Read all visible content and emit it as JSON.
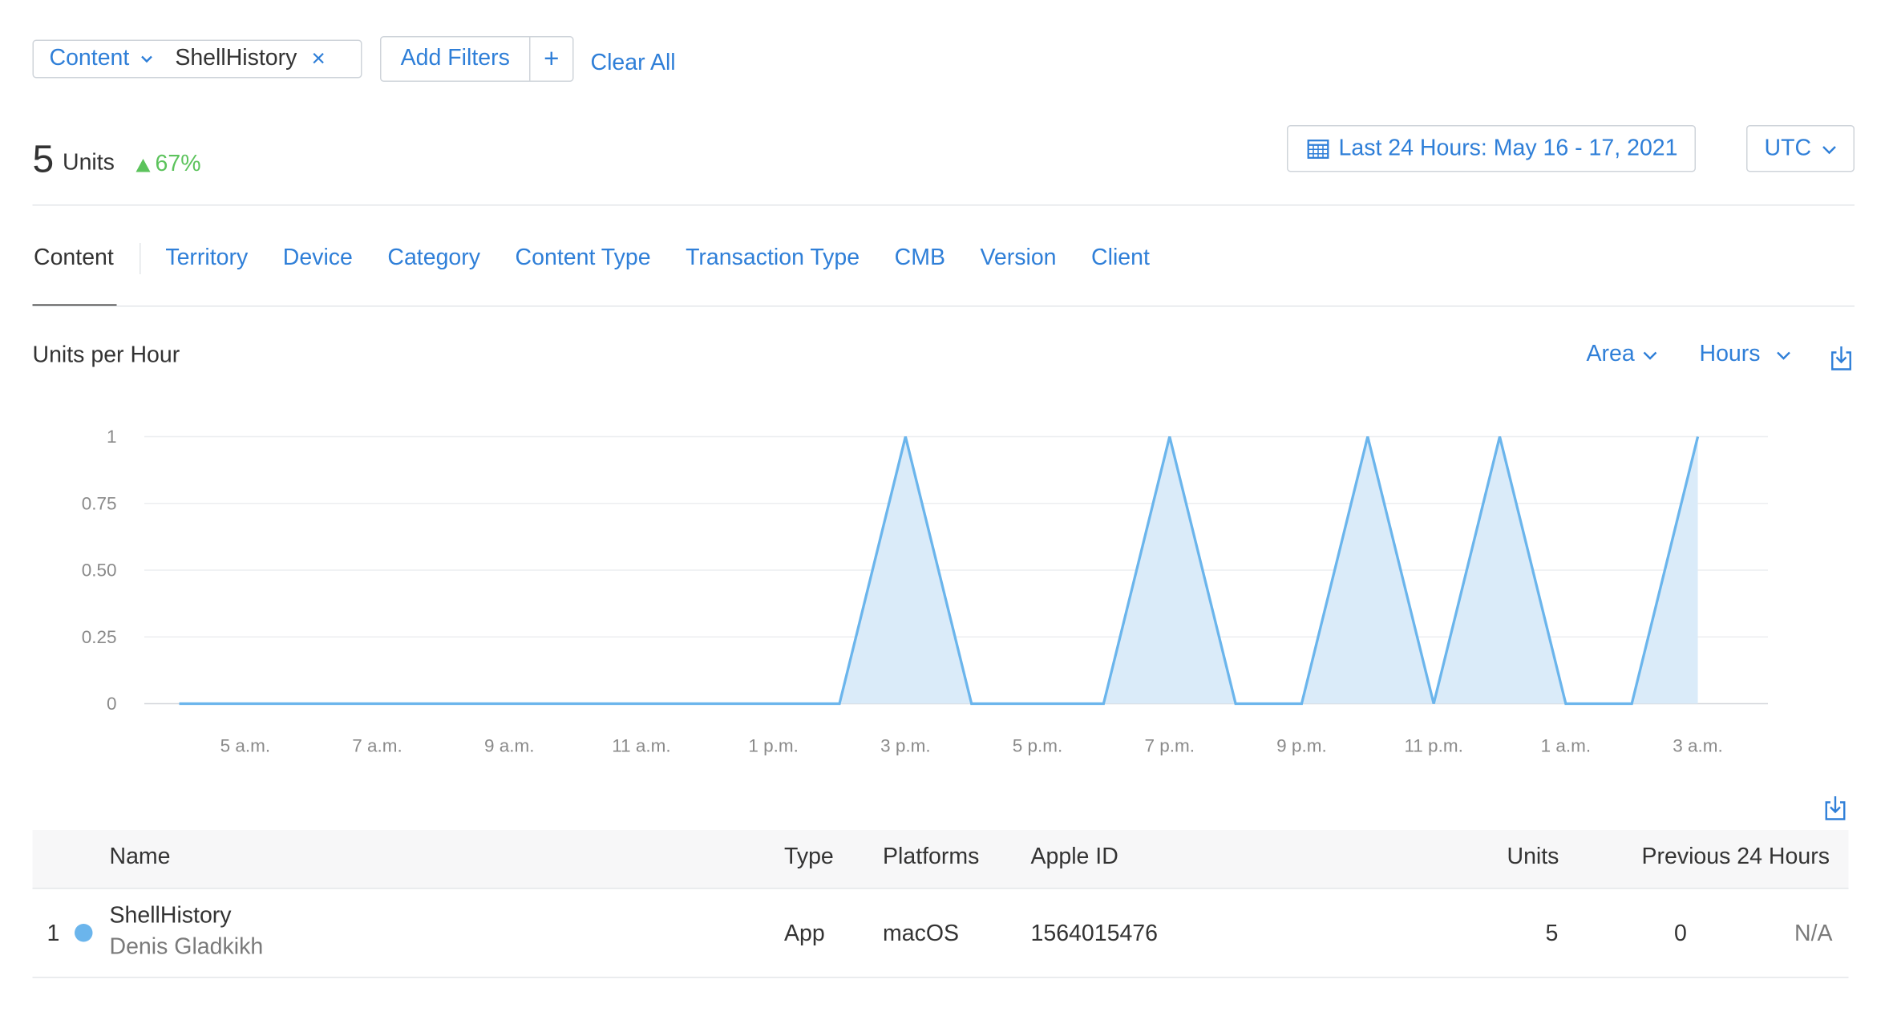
{
  "filters": {
    "active": {
      "label": "Content",
      "value": "ShellHistory",
      "remove_symbol": "×"
    },
    "add_label": "Add Filters",
    "add_plus": "+",
    "clear_all": "Clear All"
  },
  "summary": {
    "units_value": "5",
    "units_label": "Units",
    "change": "67%",
    "change_direction": "up",
    "change_color": "#5cc35c"
  },
  "date_range": {
    "label": "Last 24 Hours: May 16 - 17, 2021"
  },
  "timezone": {
    "label": "UTC"
  },
  "tabs": [
    {
      "label": "Content",
      "active": true
    },
    {
      "label": "Territory"
    },
    {
      "label": "Device"
    },
    {
      "label": "Category"
    },
    {
      "label": "Content Type"
    },
    {
      "label": "Transaction Type"
    },
    {
      "label": "CMB"
    },
    {
      "label": "Version"
    },
    {
      "label": "Client"
    }
  ],
  "chart_header": {
    "title": "Units per Hour",
    "chart_type_label": "Area",
    "interval_label": "Hours"
  },
  "chart_data": {
    "type": "area",
    "title": "Units per Hour",
    "x_tick_labels": [
      "5 a.m.",
      "7 a.m.",
      "9 a.m.",
      "11 a.m.",
      "1 p.m.",
      "3 p.m.",
      "5 p.m.",
      "7 p.m.",
      "9 p.m.",
      "11 p.m.",
      "1 a.m.",
      "3 a.m."
    ],
    "y_tick_labels": [
      "0",
      "0.25",
      "0.50",
      "0.75",
      "1"
    ],
    "ylim": [
      0,
      1
    ],
    "grid": true,
    "series": [
      {
        "color": "#6bb5ec",
        "fill": "#daebf9",
        "x": [
          "4 a.m.",
          "5 a.m.",
          "6 a.m.",
          "7 a.m.",
          "8 a.m.",
          "9 a.m.",
          "10 a.m.",
          "11 a.m.",
          "12 p.m.",
          "1 p.m.",
          "2 p.m.",
          "3 p.m.",
          "4 p.m.",
          "5 p.m.",
          "6 p.m.",
          "7 p.m.",
          "8 p.m.",
          "9 p.m.",
          "10 p.m.",
          "11 p.m.",
          "12 a.m.",
          "1 a.m.",
          "2 a.m.",
          "3 a.m."
        ],
        "values": [
          0,
          0,
          0,
          0,
          0,
          0,
          0,
          0,
          0,
          0,
          0,
          1,
          0,
          0,
          0,
          1,
          0,
          0,
          1,
          0,
          1,
          0,
          0,
          1
        ]
      }
    ]
  },
  "table": {
    "columns": {
      "name": "Name",
      "type": "Type",
      "platforms": "Platforms",
      "apple_id": "Apple ID",
      "units": "Units",
      "previous": "Previous 24 Hours"
    },
    "rows": [
      {
        "rank": "1",
        "color": "#6bb5ec",
        "name": "ShellHistory",
        "developer": "Denis Gladkikh",
        "type": "App",
        "platforms": "macOS",
        "apple_id": "1564015476",
        "units": "5",
        "previous": "0",
        "change": "N/A"
      }
    ]
  },
  "icons": [
    "chevron-down-icon",
    "close-icon",
    "plus-icon",
    "calendar-icon",
    "download-icon"
  ]
}
